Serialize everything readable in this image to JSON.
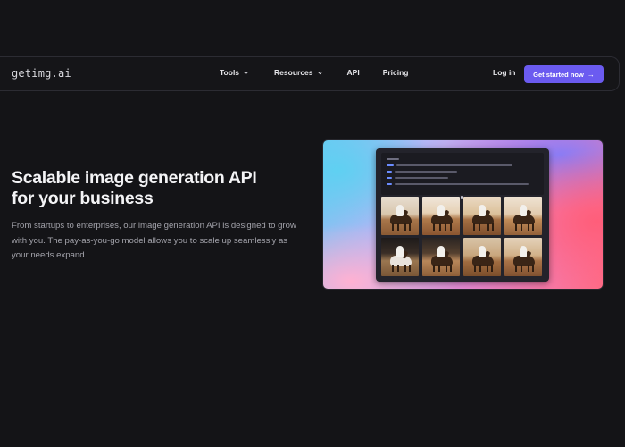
{
  "brand": {
    "logo_text": "getimg.ai"
  },
  "nav": {
    "links": [
      {
        "label": "Tools",
        "has_dropdown": true
      },
      {
        "label": "Resources",
        "has_dropdown": true
      },
      {
        "label": "API",
        "has_dropdown": false
      },
      {
        "label": "Pricing",
        "has_dropdown": false
      }
    ],
    "login_label": "Log in",
    "cta_label": "Get started now",
    "cta_icon": "arrow-right-icon"
  },
  "hero": {
    "title": "Scalable image generation API for your business",
    "description": "From startups to enterprises, our image generation API is designed to grow with you. The pay-as-you-go model allows you to scale up seamlessly as your needs expand.",
    "image": {
      "kind": "api-console-preview",
      "thumbnail_count": 8
    }
  },
  "colors": {
    "background": "#141417",
    "accent": "#6b5bf0",
    "text_primary": "#f4f4f6",
    "text_secondary": "#a3a3ab"
  }
}
